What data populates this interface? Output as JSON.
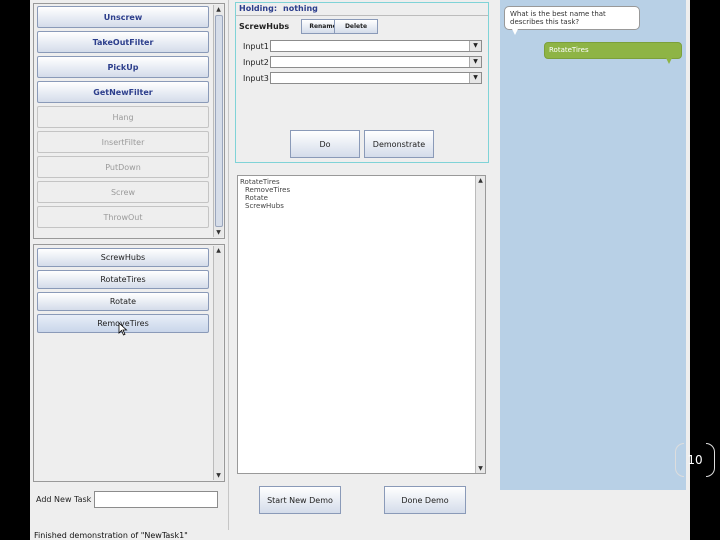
{
  "primitives": {
    "buttons": [
      {
        "label": "Unscrew",
        "enabled": true
      },
      {
        "label": "TakeOutFilter",
        "enabled": true
      },
      {
        "label": "PickUp",
        "enabled": true
      },
      {
        "label": "GetNewFilter",
        "enabled": true
      },
      {
        "label": "Hang",
        "enabled": false
      },
      {
        "label": "InsertFilter",
        "enabled": false
      },
      {
        "label": "PutDown",
        "enabled": false
      },
      {
        "label": "Screw",
        "enabled": false
      },
      {
        "label": "ThrowOut",
        "enabled": false
      }
    ]
  },
  "tasks": {
    "buttons": [
      "ScrewHubs",
      "RotateTires",
      "Rotate",
      "RemoveTires"
    ]
  },
  "add_task": {
    "label": "Add New Task",
    "value": ""
  },
  "status_bar": {
    "text": "Finished demonstration of \"NewTask1\""
  },
  "action_panel": {
    "holding_label": "Holding:",
    "holding_value": "nothing",
    "task_name": "ScrewHubs",
    "rename_label": "Rename",
    "delete_label": "Delete",
    "inputs": [
      {
        "label": "Input1",
        "value": ""
      },
      {
        "label": "Input2",
        "value": ""
      },
      {
        "label": "Input3",
        "value": ""
      }
    ],
    "do_label": "Do",
    "demonstrate_label": "Demonstrate"
  },
  "task_tree": {
    "root": "RotateTires",
    "children": [
      "RemoveTires",
      "Rotate",
      "ScrewHubs"
    ]
  },
  "demo_buttons": {
    "start": "Start New Demo",
    "done": "Done Demo"
  },
  "chat": {
    "question": "What is the best name that describes this task?",
    "answer": "RotateTires",
    "colors": {
      "background": "#b8d0e6",
      "answer_bubble": "#8eb445"
    }
  },
  "slide": {
    "page_number": "10"
  }
}
